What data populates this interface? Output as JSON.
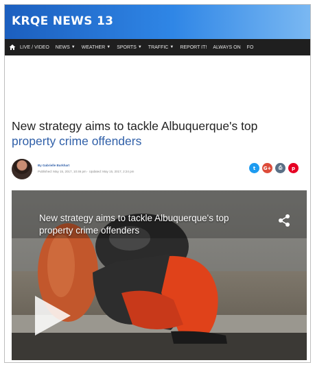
{
  "masthead": {
    "logo": "KRQE NEWS 13"
  },
  "nav": {
    "items": [
      {
        "label": "LIVE / VIDEO",
        "dropdown": false
      },
      {
        "label": "NEWS",
        "dropdown": true
      },
      {
        "label": "WEATHER",
        "dropdown": true
      },
      {
        "label": "SPORTS",
        "dropdown": true
      },
      {
        "label": "TRAFFIC",
        "dropdown": true
      },
      {
        "label": "REPORT IT!",
        "dropdown": false
      },
      {
        "label": "ALWAYS ON",
        "dropdown": false
      },
      {
        "label": "FO",
        "dropdown": false
      }
    ]
  },
  "article": {
    "headline_line1": "New strategy aims to tackle Albuquerque's top",
    "headline_line2": "property crime offenders",
    "author": "By Gabrielle Burkhart",
    "dates": "Published: May 15, 2017, 10:46 pm  ·  Updated: May 15, 2017, 2:24 pm"
  },
  "share_icons": [
    {
      "icon": "twitter-icon",
      "glyph": "t",
      "color": "#1d9bf0"
    },
    {
      "icon": "google-plus-icon",
      "glyph": "G+",
      "color": "#dd4b39"
    },
    {
      "icon": "print-icon",
      "glyph": "⎙",
      "color": "#5a6f85"
    },
    {
      "icon": "pinterest-icon",
      "glyph": "p",
      "color": "#e60023"
    }
  ],
  "video": {
    "title": "New strategy aims to tackle Albuquerque's top property crime offenders"
  }
}
